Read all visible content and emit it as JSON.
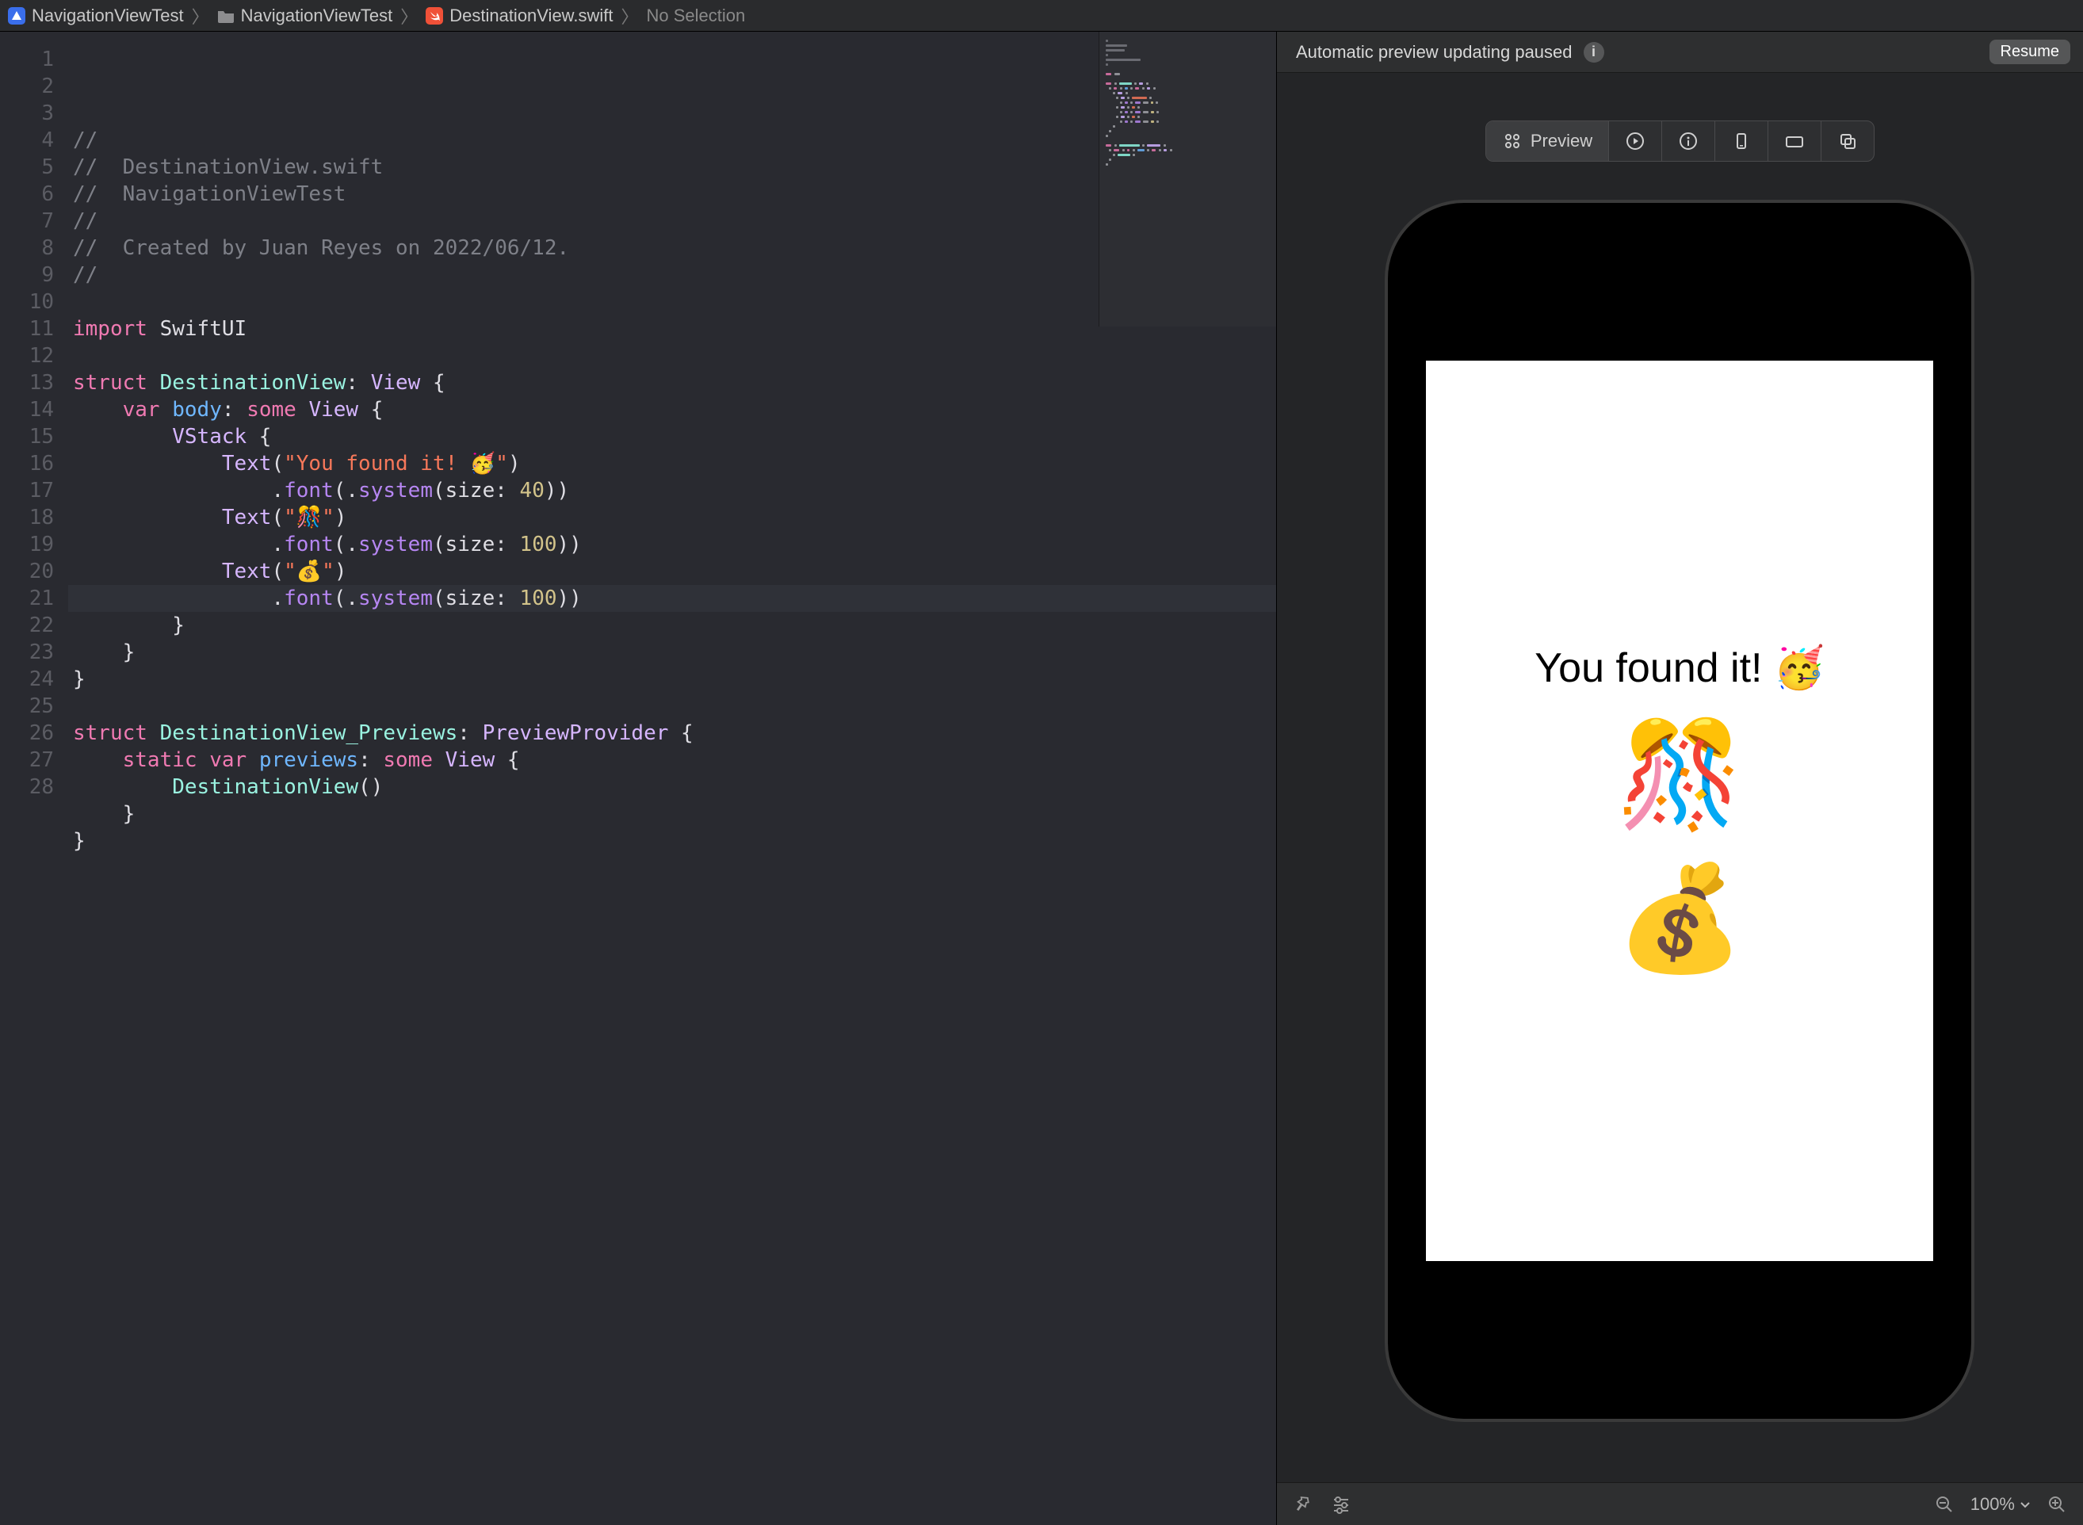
{
  "breadcrumb": {
    "project": "NavigationViewTest",
    "group": "NavigationViewTest",
    "file": "DestinationView.swift",
    "selection": "No Selection"
  },
  "editor": {
    "lines": [
      {
        "n": 1,
        "seg": [
          {
            "c": "tok-comment",
            "t": "//"
          }
        ]
      },
      {
        "n": 2,
        "seg": [
          {
            "c": "tok-comment",
            "t": "//  DestinationView.swift"
          }
        ]
      },
      {
        "n": 3,
        "seg": [
          {
            "c": "tok-comment",
            "t": "//  NavigationViewTest"
          }
        ]
      },
      {
        "n": 4,
        "seg": [
          {
            "c": "tok-comment",
            "t": "//"
          }
        ]
      },
      {
        "n": 5,
        "seg": [
          {
            "c": "tok-comment",
            "t": "//  Created by Juan Reyes on 2022/06/12."
          }
        ]
      },
      {
        "n": 6,
        "seg": [
          {
            "c": "tok-comment",
            "t": "//"
          }
        ]
      },
      {
        "n": 7,
        "seg": []
      },
      {
        "n": 8,
        "seg": [
          {
            "c": "tok-kw",
            "t": "import"
          },
          {
            "c": "tok-plain",
            "t": " SwiftUI"
          }
        ]
      },
      {
        "n": 9,
        "seg": []
      },
      {
        "n": 10,
        "seg": [
          {
            "c": "tok-kw",
            "t": "struct"
          },
          {
            "c": "tok-plain",
            "t": " "
          },
          {
            "c": "tok-type",
            "t": "DestinationView"
          },
          {
            "c": "tok-plain",
            "t": ": "
          },
          {
            "c": "tok-type2",
            "t": "View"
          },
          {
            "c": "tok-plain",
            "t": " {"
          }
        ]
      },
      {
        "n": 11,
        "seg": [
          {
            "c": "tok-plain",
            "t": "    "
          },
          {
            "c": "tok-kw",
            "t": "var"
          },
          {
            "c": "tok-plain",
            "t": " "
          },
          {
            "c": "tok-id",
            "t": "body"
          },
          {
            "c": "tok-plain",
            "t": ": "
          },
          {
            "c": "tok-kw",
            "t": "some"
          },
          {
            "c": "tok-plain",
            "t": " "
          },
          {
            "c": "tok-type2",
            "t": "View"
          },
          {
            "c": "tok-plain",
            "t": " {"
          }
        ]
      },
      {
        "n": 12,
        "seg": [
          {
            "c": "tok-plain",
            "t": "        "
          },
          {
            "c": "tok-type2",
            "t": "VStack"
          },
          {
            "c": "tok-plain",
            "t": " {"
          }
        ]
      },
      {
        "n": 13,
        "seg": [
          {
            "c": "tok-plain",
            "t": "            "
          },
          {
            "c": "tok-type2",
            "t": "Text"
          },
          {
            "c": "tok-plain",
            "t": "("
          },
          {
            "c": "tok-string",
            "t": "\"You found it! 🥳\""
          },
          {
            "c": "tok-plain",
            "t": ")"
          }
        ]
      },
      {
        "n": 14,
        "seg": [
          {
            "c": "tok-plain",
            "t": "                ."
          },
          {
            "c": "tok-func",
            "t": "font"
          },
          {
            "c": "tok-plain",
            "t": "(."
          },
          {
            "c": "tok-func",
            "t": "system"
          },
          {
            "c": "tok-plain",
            "t": "(size: "
          },
          {
            "c": "tok-num",
            "t": "40"
          },
          {
            "c": "tok-plain",
            "t": "))"
          }
        ]
      },
      {
        "n": 15,
        "seg": [
          {
            "c": "tok-plain",
            "t": "            "
          },
          {
            "c": "tok-type2",
            "t": "Text"
          },
          {
            "c": "tok-plain",
            "t": "("
          },
          {
            "c": "tok-string",
            "t": "\"🎊\""
          },
          {
            "c": "tok-plain",
            "t": ")"
          }
        ]
      },
      {
        "n": 16,
        "seg": [
          {
            "c": "tok-plain",
            "t": "                ."
          },
          {
            "c": "tok-func",
            "t": "font"
          },
          {
            "c": "tok-plain",
            "t": "(."
          },
          {
            "c": "tok-func",
            "t": "system"
          },
          {
            "c": "tok-plain",
            "t": "(size: "
          },
          {
            "c": "tok-num",
            "t": "100"
          },
          {
            "c": "tok-plain",
            "t": "))"
          }
        ]
      },
      {
        "n": 17,
        "seg": [
          {
            "c": "tok-plain",
            "t": "            "
          },
          {
            "c": "tok-type2",
            "t": "Text"
          },
          {
            "c": "tok-plain",
            "t": "("
          },
          {
            "c": "tok-string",
            "t": "\"💰\""
          },
          {
            "c": "tok-plain",
            "t": ")"
          }
        ]
      },
      {
        "n": 18,
        "seg": [
          {
            "c": "tok-plain",
            "t": "                ."
          },
          {
            "c": "tok-func",
            "t": "font"
          },
          {
            "c": "tok-plain",
            "t": "(."
          },
          {
            "c": "tok-func",
            "t": "system"
          },
          {
            "c": "tok-plain",
            "t": "(size: "
          },
          {
            "c": "tok-num",
            "t": "100"
          },
          {
            "c": "tok-plain",
            "t": "))"
          }
        ]
      },
      {
        "n": 19,
        "seg": [
          {
            "c": "tok-plain",
            "t": "        }"
          }
        ]
      },
      {
        "n": 20,
        "seg": [
          {
            "c": "tok-plain",
            "t": "    }"
          }
        ]
      },
      {
        "n": 21,
        "seg": [
          {
            "c": "tok-plain",
            "t": "}"
          }
        ]
      },
      {
        "n": 22,
        "seg": []
      },
      {
        "n": 23,
        "seg": [
          {
            "c": "tok-kw",
            "t": "struct"
          },
          {
            "c": "tok-plain",
            "t": " "
          },
          {
            "c": "tok-type",
            "t": "DestinationView_Previews"
          },
          {
            "c": "tok-plain",
            "t": ": "
          },
          {
            "c": "tok-type2",
            "t": "PreviewProvider"
          },
          {
            "c": "tok-plain",
            "t": " {"
          }
        ]
      },
      {
        "n": 24,
        "seg": [
          {
            "c": "tok-plain",
            "t": "    "
          },
          {
            "c": "tok-kw",
            "t": "static"
          },
          {
            "c": "tok-plain",
            "t": " "
          },
          {
            "c": "tok-kw",
            "t": "var"
          },
          {
            "c": "tok-plain",
            "t": " "
          },
          {
            "c": "tok-id",
            "t": "previews"
          },
          {
            "c": "tok-plain",
            "t": ": "
          },
          {
            "c": "tok-kw",
            "t": "some"
          },
          {
            "c": "tok-plain",
            "t": " "
          },
          {
            "c": "tok-type2",
            "t": "View"
          },
          {
            "c": "tok-plain",
            "t": " {"
          }
        ]
      },
      {
        "n": 25,
        "seg": [
          {
            "c": "tok-plain",
            "t": "        "
          },
          {
            "c": "tok-type",
            "t": "DestinationView"
          },
          {
            "c": "tok-plain",
            "t": "()"
          }
        ]
      },
      {
        "n": 26,
        "seg": [
          {
            "c": "tok-plain",
            "t": "    }"
          }
        ]
      },
      {
        "n": 27,
        "seg": [
          {
            "c": "tok-plain",
            "t": "}"
          }
        ]
      },
      {
        "n": 28,
        "seg": []
      }
    ],
    "highlight_line": 21
  },
  "canvas": {
    "status": "Automatic preview updating paused",
    "resume": "Resume",
    "segments": {
      "preview": "Preview"
    },
    "device_text1": "You found it! 🥳",
    "device_text2": "🎊",
    "device_text3": "💰",
    "zoom": "100%"
  }
}
